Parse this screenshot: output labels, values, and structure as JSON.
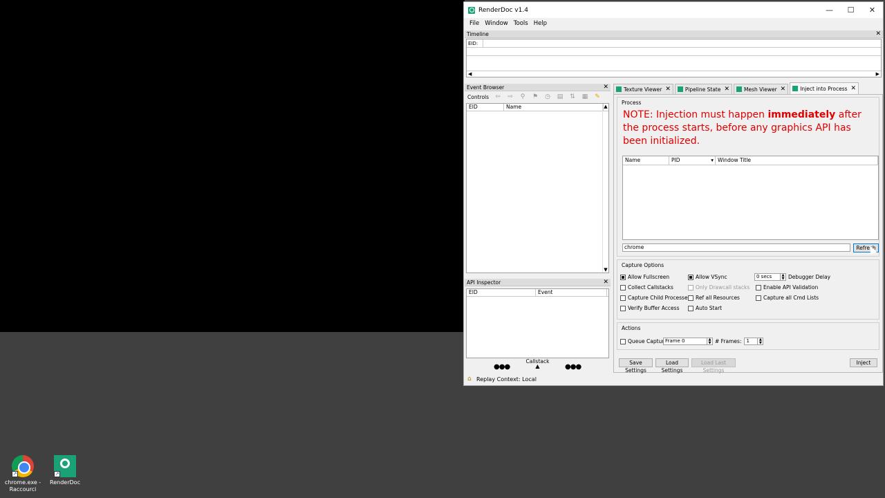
{
  "desktop": {
    "icons": [
      {
        "label": "chrome.exe - Raccourci",
        "icon": "chrome-icon"
      },
      {
        "label": "RenderDoc",
        "icon": "renderdoc-icon"
      }
    ]
  },
  "window": {
    "title": "RenderDoc v1.4",
    "buttons": {
      "minimize": "—",
      "maximize": "☐",
      "close": "✕"
    }
  },
  "menu": [
    "File",
    "Window",
    "Tools",
    "Help"
  ],
  "timeline": {
    "title": "Timeline",
    "eid_label": "EID:"
  },
  "event_browser": {
    "title": "Event Browser",
    "controls_label": "Controls",
    "columns": [
      "EID",
      "Name"
    ]
  },
  "api_inspector": {
    "title": "API Inspector",
    "columns": [
      "EID",
      "Event"
    ],
    "callstack_label": "Callstack"
  },
  "tabs": [
    {
      "label": "Texture Viewer",
      "active": false
    },
    {
      "label": "Pipeline State",
      "active": false
    },
    {
      "label": "Mesh Viewer",
      "active": false
    },
    {
      "label": "Inject into Process",
      "active": true
    }
  ],
  "process": {
    "group_title": "Process",
    "note_prefix": "NOTE: Injection must happen ",
    "note_bold": "immediately",
    "note_suffix": " after the process starts, before any graphics API has been initialized.",
    "columns": [
      "Name",
      "PID",
      "Window Title"
    ],
    "filter_value": "chrome",
    "refresh_label": "Refresh"
  },
  "capture_options": {
    "group_title": "Capture Options",
    "allow_fullscreen": "Allow Fullscreen",
    "allow_vsync": "Allow VSync",
    "debugger_delay_value": "0 secs",
    "debugger_delay_label": "Debugger Delay",
    "collect_callstacks": "Collect Callstacks",
    "only_drawcall_stacks": "Only Drawcall stacks",
    "enable_api_validation": "Enable API Validation",
    "capture_child_processes": "Capture Child Processes",
    "ref_all_resources": "Ref all Resources",
    "capture_all_cmd_lists": "Capture all Cmd Lists",
    "verify_buffer_access": "Verify Buffer Access",
    "auto_start": "Auto Start"
  },
  "actions": {
    "group_title": "Actions",
    "queue_capture": "Queue Capture",
    "frame_value": "Frame 0",
    "num_frames_label": "# Frames:",
    "num_frames_value": "1"
  },
  "buttons": {
    "save_settings": "Save Settings",
    "load_settings": "Load Settings",
    "load_last_settings": "Load Last Settings",
    "inject": "Inject"
  },
  "status": {
    "text": "Replay Context: Local"
  }
}
